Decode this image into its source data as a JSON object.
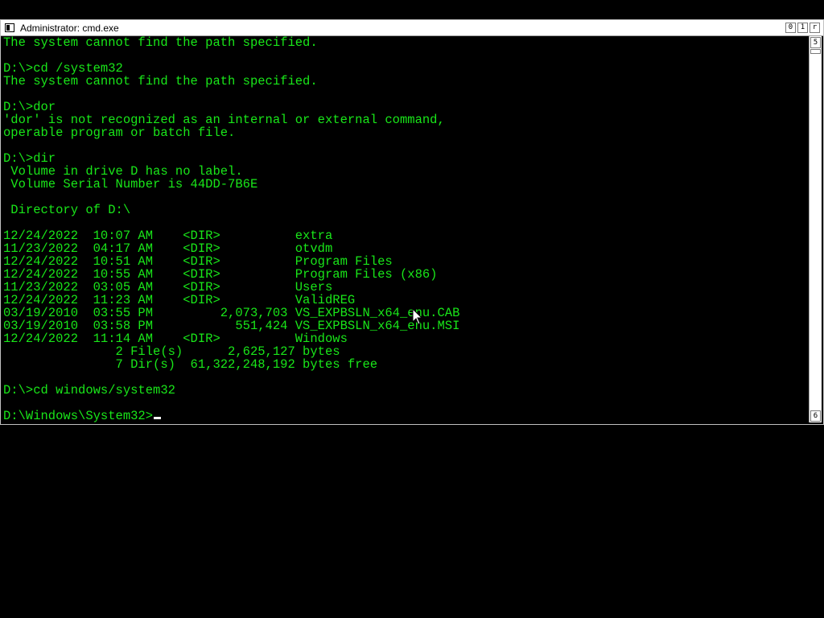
{
  "window": {
    "title": "Administrator: cmd.exe",
    "buttons": {
      "minimize": "0",
      "maximize": "1",
      "close": "r"
    }
  },
  "console": {
    "text_color": "#19e619",
    "background": "#000000",
    "lines": [
      "The system cannot find the path specified.",
      "",
      "D:\\>cd /system32",
      "The system cannot find the path specified.",
      "",
      "D:\\>dor",
      "'dor' is not recognized as an internal or external command,",
      "operable program or batch file.",
      "",
      "D:\\>dir",
      " Volume in drive D has no label.",
      " Volume Serial Number is 44DD-7B6E",
      "",
      " Directory of D:\\",
      "",
      "12/24/2022  10:07 AM    <DIR>          extra",
      "11/23/2022  04:17 AM    <DIR>          otvdm",
      "12/24/2022  10:51 AM    <DIR>          Program Files",
      "12/24/2022  10:55 AM    <DIR>          Program Files (x86)",
      "11/23/2022  03:05 AM    <DIR>          Users",
      "12/24/2022  11:23 AM    <DIR>          ValidREG",
      "03/19/2010  03:55 PM         2,073,703 VS_EXPBSLN_x64_enu.CAB",
      "03/19/2010  03:58 PM           551,424 VS_EXPBSLN_x64_enu.MSI",
      "12/24/2022  11:14 AM    <DIR>          Windows",
      "               2 File(s)      2,625,127 bytes",
      "               7 Dir(s)  61,322,248,192 bytes free",
      "",
      "D:\\>cd windows/system32",
      "",
      "D:\\Windows\\System32>"
    ]
  },
  "scrollbar": {
    "up_glyph": "5",
    "down_glyph": "6"
  },
  "icons": {
    "window_icon": "console-icon",
    "pointer": "mouse-pointer-icon"
  }
}
